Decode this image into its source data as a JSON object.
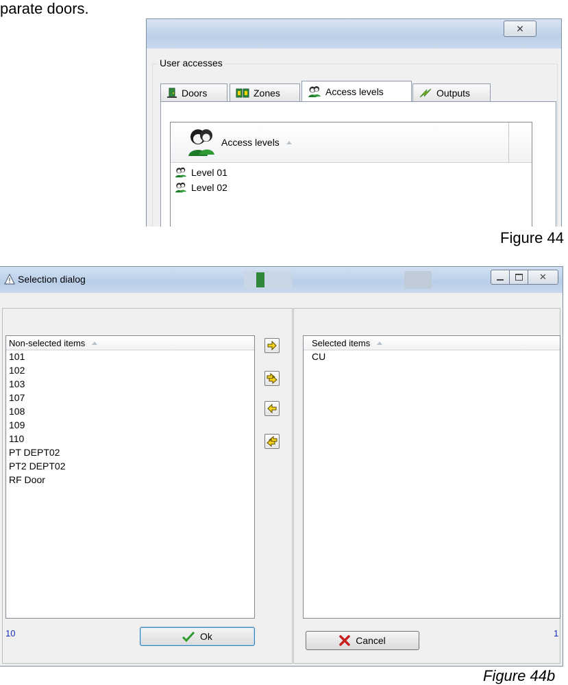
{
  "document": {
    "top_fragment": "parate doors.",
    "figure44_caption": "Figure 44",
    "figure44b_caption": "Figure 44b"
  },
  "figure44": {
    "close_glyph": "✕",
    "group_label": "User accesses",
    "tabs": [
      {
        "label": "Doors",
        "icon": "door-icon",
        "active": false
      },
      {
        "label": "Zones",
        "icon": "zones-icon",
        "active": false
      },
      {
        "label": "Access levels",
        "icon": "access-level-icon",
        "active": true
      },
      {
        "label": "Outputs",
        "icon": "outputs-icon",
        "active": false
      }
    ],
    "list": {
      "header": "Access levels",
      "header_icon": "users-icon",
      "items": [
        "Level 01",
        "Level 02"
      ]
    }
  },
  "selection_dialog": {
    "title": "Selection dialog",
    "left": {
      "header": "Non-selected items",
      "items": [
        "101",
        "102",
        "103",
        "107",
        "108",
        "109",
        "110",
        "PT DEPT02",
        "PT2 DEPT02",
        "RF Door"
      ],
      "count": "10"
    },
    "right": {
      "header": "Selected items",
      "items": [
        "CU"
      ],
      "count": "1"
    },
    "arrow_buttons": [
      "move-right-icon",
      "move-all-right-icon",
      "move-left-icon",
      "move-all-left-icon"
    ],
    "ok_label": "Ok",
    "cancel_label": "Cancel",
    "colors": {
      "count_text": "#1a2dbf",
      "ok_check": "#2e9a2a",
      "cancel_x": "#c8201c",
      "arrow_fill": "#f5d21e"
    }
  }
}
